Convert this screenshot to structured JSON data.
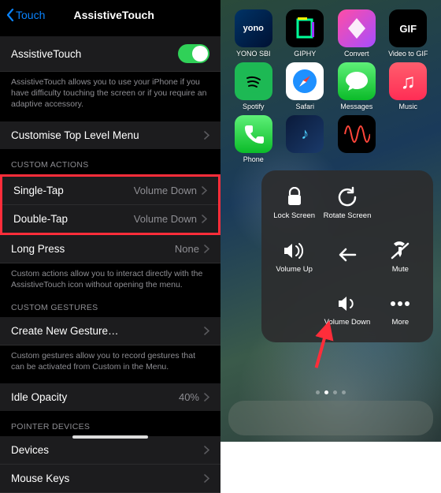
{
  "left": {
    "back": "Touch",
    "title": "AssistiveTouch",
    "toggle_label": "AssistiveTouch",
    "intro_caption": "AssistiveTouch allows you to use your iPhone if you have difficulty touching the screen or if you require an adaptive accessory.",
    "customise_label": "Customise Top Level Menu",
    "custom_actions_header": "CUSTOM ACTIONS",
    "single_tap_label": "Single-Tap",
    "single_tap_value": "Volume Down",
    "double_tap_label": "Double-Tap",
    "double_tap_value": "Volume Down",
    "long_press_label": "Long Press",
    "long_press_value": "None",
    "actions_caption": "Custom actions allow you to interact directly with the AssistiveTouch icon without opening the menu.",
    "custom_gestures_header": "CUSTOM GESTURES",
    "new_gesture_label": "Create New Gesture…",
    "gestures_caption": "Custom gestures allow you to record gestures that can be activated from Custom in the Menu.",
    "idle_opacity_label": "Idle Opacity",
    "idle_opacity_value": "40%",
    "pointer_header": "POINTER DEVICES",
    "devices_label": "Devices",
    "mouse_keys_label": "Mouse Keys"
  },
  "right": {
    "apps": [
      {
        "name": "YONO SBI",
        "cls": "yono",
        "g": "yono"
      },
      {
        "name": "GIPHY",
        "cls": "giphy",
        "g": "▮"
      },
      {
        "name": "Convert",
        "cls": "convert",
        "g": ""
      },
      {
        "name": "Video to GIF",
        "cls": "v2g",
        "g": "GIF"
      },
      {
        "name": "Spotify",
        "cls": "spotify",
        "g": ""
      },
      {
        "name": "Safari",
        "cls": "safari",
        "g": ""
      },
      {
        "name": "Messages",
        "cls": "messages",
        "g": ""
      },
      {
        "name": "Music",
        "cls": "music",
        "g": "♪"
      },
      {
        "name": "Phone",
        "cls": "phone",
        "g": ""
      },
      {
        "name": "",
        "cls": "dsp",
        "g": "♪"
      },
      {
        "name": "",
        "cls": "voicememo",
        "g": ""
      }
    ],
    "atouch": {
      "lock": "Lock Screen",
      "rotate": "Rotate Screen",
      "volup": "Volume Up",
      "mute": "Mute",
      "voldown": "Volume Down",
      "more": "More"
    }
  }
}
